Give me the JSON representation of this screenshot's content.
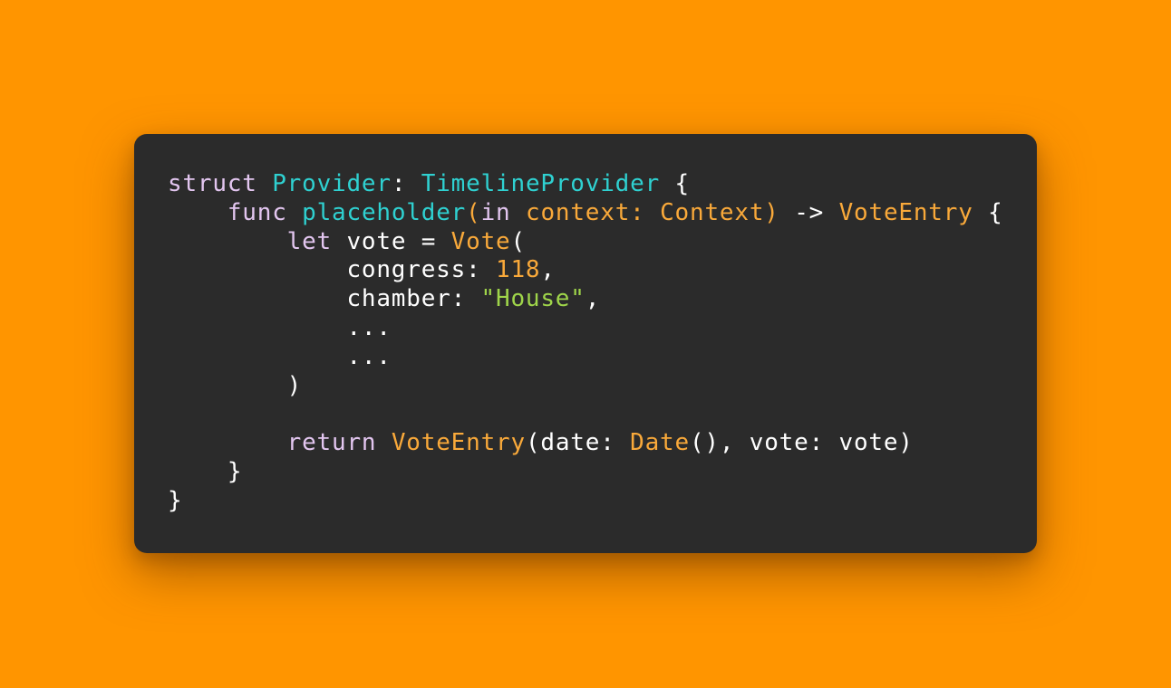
{
  "colors": {
    "background": "#FF9500",
    "card": "#2B2B2B",
    "keyword": "#E3C6F0",
    "type_declaration": "#2FD1D1",
    "type_reference": "#F9A93A",
    "number": "#F9A93A",
    "string": "#9FD54A",
    "plain": "#FFFFFF"
  },
  "code": {
    "language": "swift",
    "lines": [
      {
        "tokens": [
          {
            "text": "struct",
            "kind": "keyword"
          },
          {
            "text": " ",
            "kind": "plain"
          },
          {
            "text": "Provider",
            "kind": "type_declaration"
          },
          {
            "text": ": ",
            "kind": "plain"
          },
          {
            "text": "TimelineProvider",
            "kind": "type_declaration"
          },
          {
            "text": " {",
            "kind": "plain"
          }
        ]
      },
      {
        "tokens": [
          {
            "text": "    ",
            "kind": "plain"
          },
          {
            "text": "func",
            "kind": "keyword"
          },
          {
            "text": " ",
            "kind": "plain"
          },
          {
            "text": "placeholder",
            "kind": "type_declaration"
          },
          {
            "text": "(",
            "kind": "type_reference"
          },
          {
            "text": "in",
            "kind": "keyword"
          },
          {
            "text": " ",
            "kind": "plain"
          },
          {
            "text": "context",
            "kind": "type_reference"
          },
          {
            "text": ": ",
            "kind": "type_reference"
          },
          {
            "text": "Context",
            "kind": "type_reference"
          },
          {
            "text": ")",
            "kind": "type_reference"
          },
          {
            "text": " -> ",
            "kind": "plain"
          },
          {
            "text": "VoteEntry",
            "kind": "type_reference"
          },
          {
            "text": " {",
            "kind": "plain"
          }
        ]
      },
      {
        "tokens": [
          {
            "text": "        ",
            "kind": "plain"
          },
          {
            "text": "let",
            "kind": "keyword"
          },
          {
            "text": " vote = ",
            "kind": "plain"
          },
          {
            "text": "Vote",
            "kind": "type_reference"
          },
          {
            "text": "(",
            "kind": "plain"
          }
        ]
      },
      {
        "tokens": [
          {
            "text": "            congress: ",
            "kind": "plain"
          },
          {
            "text": "118",
            "kind": "number"
          },
          {
            "text": ",",
            "kind": "plain"
          }
        ]
      },
      {
        "tokens": [
          {
            "text": "            chamber: ",
            "kind": "plain"
          },
          {
            "text": "\"House\"",
            "kind": "string"
          },
          {
            "text": ",",
            "kind": "plain"
          }
        ]
      },
      {
        "tokens": [
          {
            "text": "            ...",
            "kind": "plain"
          }
        ]
      },
      {
        "tokens": [
          {
            "text": "            ...",
            "kind": "plain"
          }
        ]
      },
      {
        "tokens": [
          {
            "text": "        )",
            "kind": "plain"
          }
        ]
      },
      {
        "tokens": []
      },
      {
        "tokens": [
          {
            "text": "        ",
            "kind": "plain"
          },
          {
            "text": "return",
            "kind": "keyword"
          },
          {
            "text": " ",
            "kind": "plain"
          },
          {
            "text": "VoteEntry",
            "kind": "type_reference"
          },
          {
            "text": "(date: ",
            "kind": "plain"
          },
          {
            "text": "Date",
            "kind": "type_reference"
          },
          {
            "text": "(), vote: vote)",
            "kind": "plain"
          }
        ]
      },
      {
        "tokens": [
          {
            "text": "    }",
            "kind": "plain"
          }
        ]
      },
      {
        "tokens": [
          {
            "text": "}",
            "kind": "plain"
          }
        ]
      }
    ]
  }
}
